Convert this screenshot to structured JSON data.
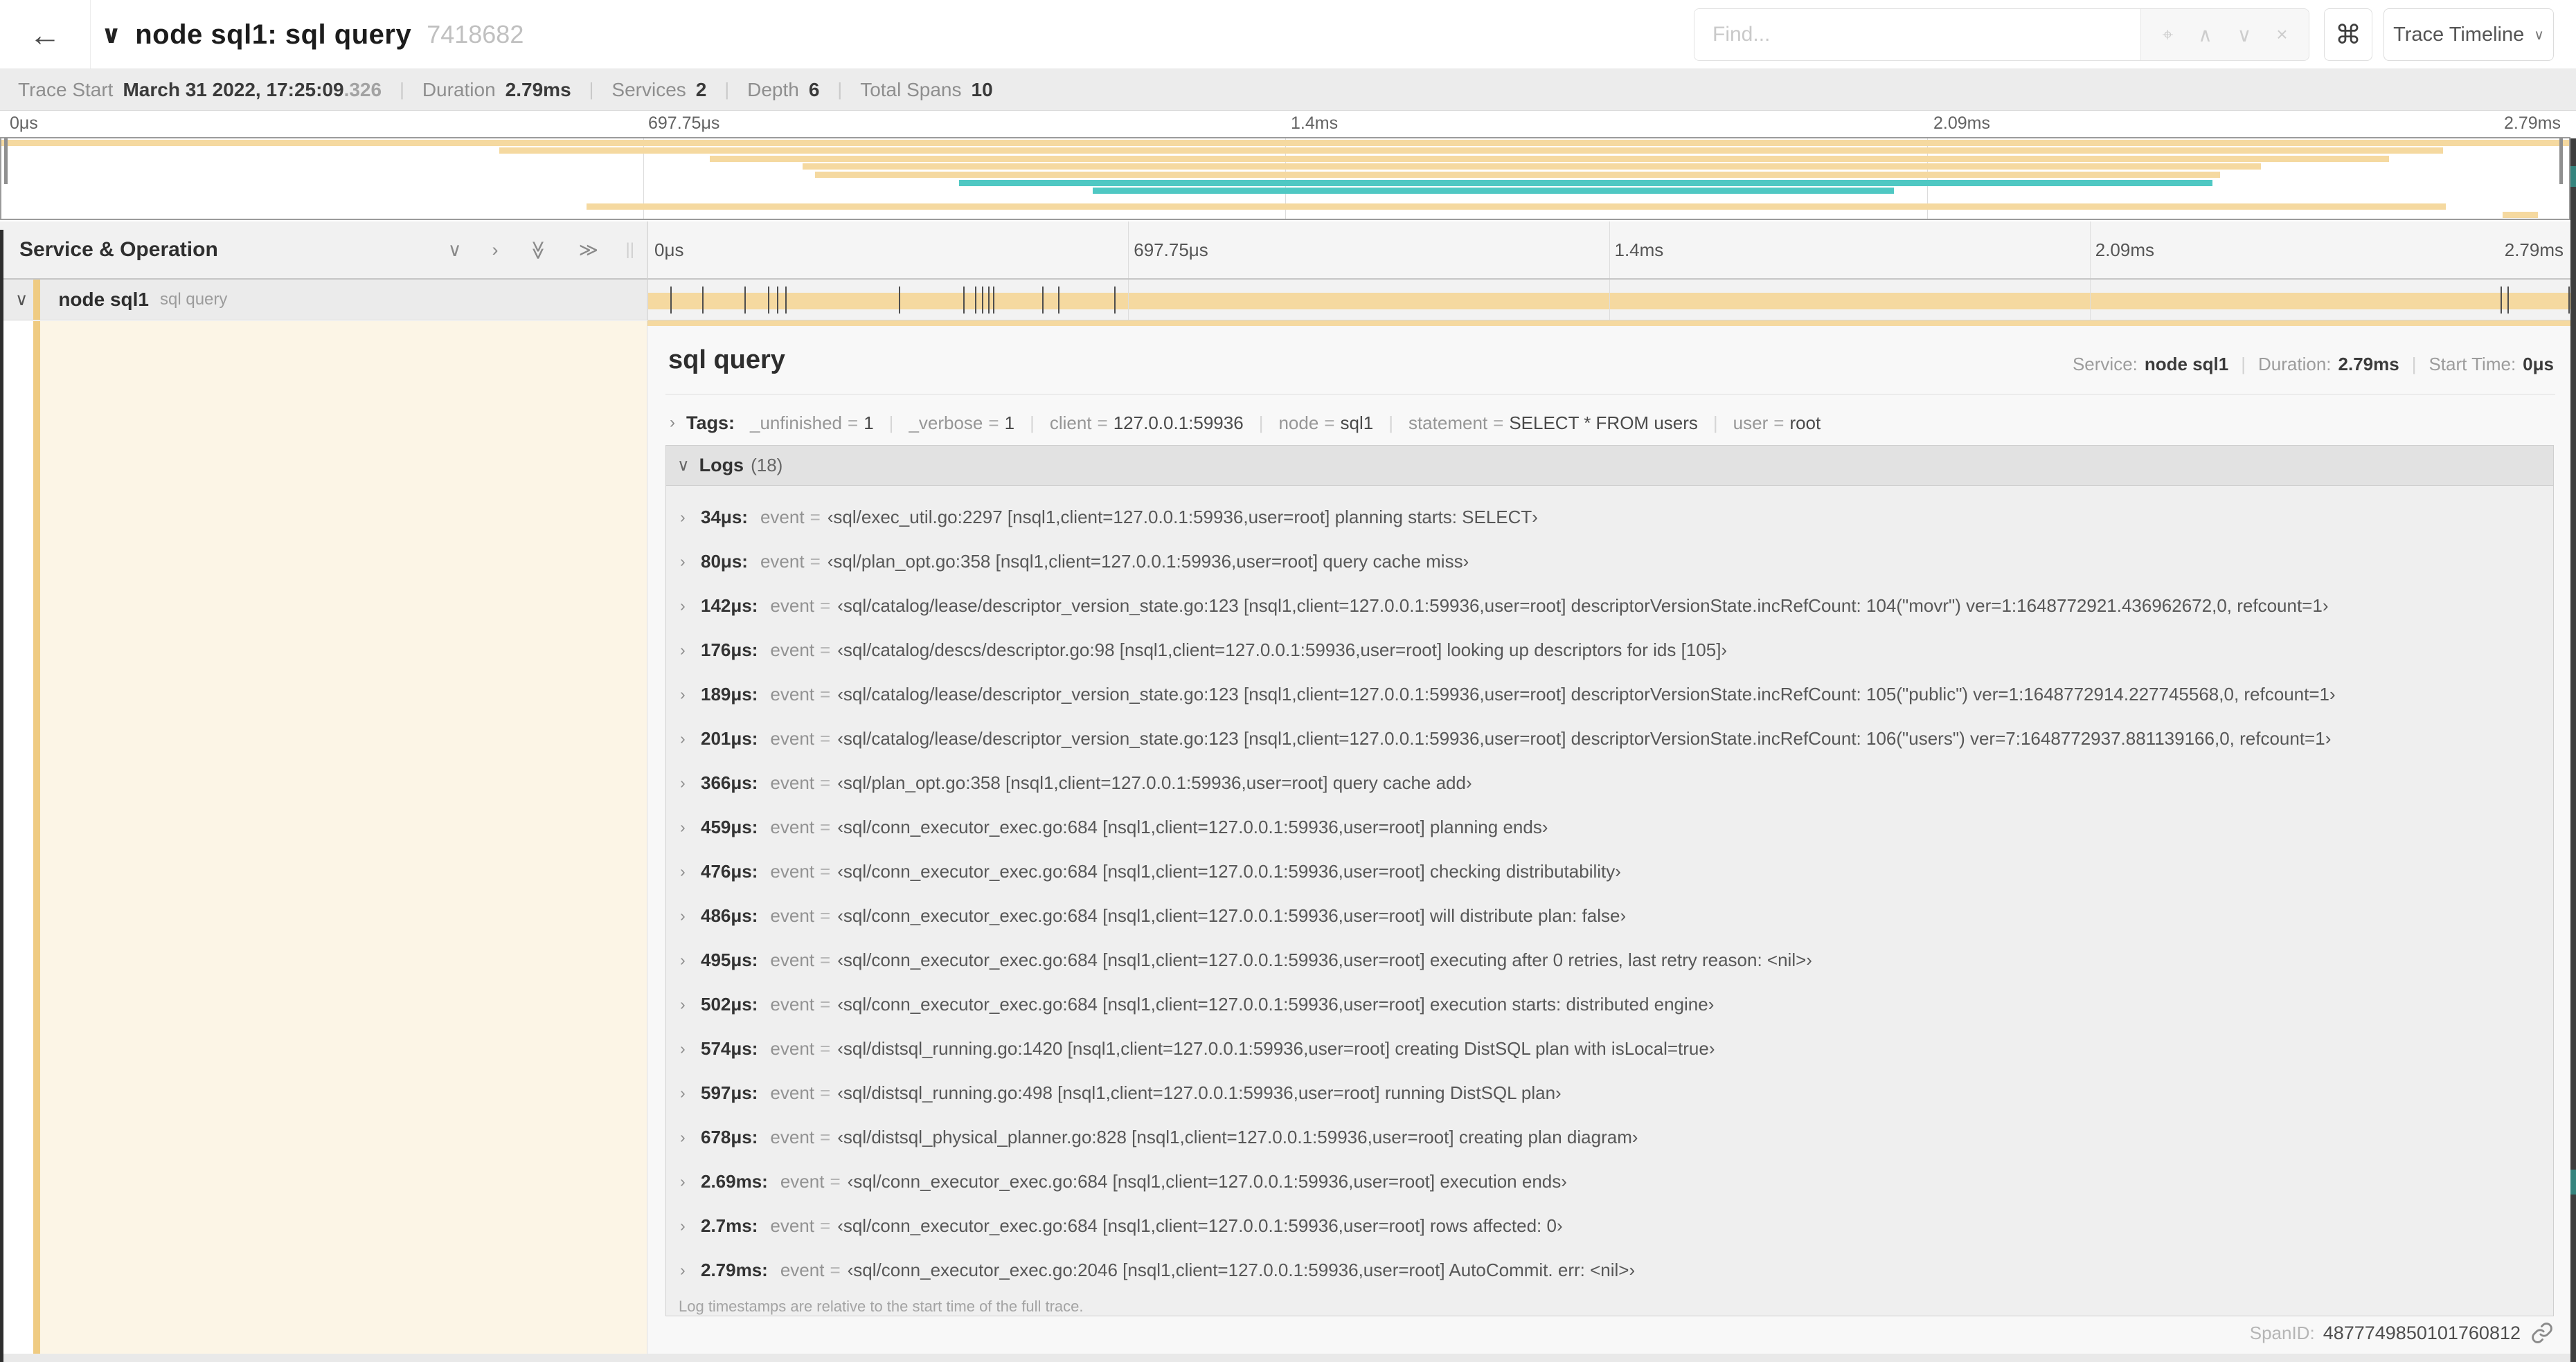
{
  "colors": {
    "span_tan": "#F5D9A0",
    "span_tan_stripe": "#EFCB82",
    "span_teal": "#4FC8C3",
    "detail_cream": "#FCF5E6"
  },
  "icons": {
    "back": "←",
    "title_chevron": "∨",
    "target": "⌖",
    "prev": "∧",
    "next": "∨",
    "clear": "×",
    "command": "⌘",
    "caret": "∨",
    "collapse_one": "∨",
    "expand_one": "›",
    "collapse_all": "≫",
    "expand_all": "≫",
    "resizer": "||",
    "row_chevron": "∨",
    "tags_chevron": "›",
    "logs_chevron": "∨",
    "log_chevron": "›"
  },
  "header": {
    "title": "node sql1: sql query",
    "trace_id": "7418682",
    "find_placeholder": "Find...",
    "trace_timeline_label": "Trace Timeline"
  },
  "summary": {
    "trace_start_label": "Trace Start",
    "trace_start_value": "March 31 2022, 17:25:09",
    "trace_start_frac": ".326",
    "duration_label": "Duration",
    "duration_value": "2.79ms",
    "services_label": "Services",
    "services_value": "2",
    "depth_label": "Depth",
    "depth_value": "6",
    "total_spans_label": "Total Spans",
    "total_spans_value": "10"
  },
  "trace": {
    "duration_us": 2790
  },
  "time_ticks": [
    "0μs",
    "697.75μs",
    "1.4ms",
    "2.09ms",
    "2.79ms"
  ],
  "minimap": {
    "bars": [
      {
        "row": 0,
        "start": 0.0,
        "end": 1.0,
        "color": "span_tan"
      },
      {
        "row": 1,
        "start": 0.194,
        "end": 0.951,
        "color": "span_tan"
      },
      {
        "row": 2,
        "start": 0.276,
        "end": 0.93,
        "color": "span_tan"
      },
      {
        "row": 3,
        "start": 0.312,
        "end": 0.88,
        "color": "span_tan"
      },
      {
        "row": 4,
        "start": 0.317,
        "end": 0.864,
        "color": "span_tan"
      },
      {
        "row": 5,
        "start": 0.373,
        "end": 0.861,
        "color": "span_teal"
      },
      {
        "row": 6,
        "start": 0.425,
        "end": 0.737,
        "color": "span_teal"
      },
      {
        "row": 8,
        "start": 0.228,
        "end": 0.952,
        "color": "span_tan"
      },
      {
        "row": 9,
        "start": 0.974,
        "end": 0.988,
        "color": "span_tan"
      }
    ]
  },
  "timeline": {
    "column_header": "Service & Operation",
    "row": {
      "service": "node sql1",
      "operation": "sql query"
    }
  },
  "detail": {
    "title": "sql query",
    "service_label": "Service:",
    "service": "node sql1",
    "duration_label": "Duration:",
    "duration": "2.79ms",
    "start_label": "Start Time:",
    "start": "0μs",
    "tags_label": "Tags:",
    "tags": [
      {
        "key": "_unfinished",
        "value": "1"
      },
      {
        "key": "_verbose",
        "value": "1"
      },
      {
        "key": "client",
        "value": "127.0.0.1:59936"
      },
      {
        "key": "node",
        "value": "sql1"
      },
      {
        "key": "statement",
        "value": "SELECT * FROM users"
      },
      {
        "key": "user",
        "value": "root"
      }
    ],
    "logs_label": "Logs",
    "logs_count": "(18)",
    "event_key": "event",
    "eq": "=",
    "logs": [
      {
        "t_us": 34,
        "time": "34μs:",
        "event": "‹sql/exec_util.go:2297 [nsql1,client=127.0.0.1:59936,user=root] planning starts: SELECT›"
      },
      {
        "t_us": 80,
        "time": "80μs:",
        "event": "‹sql/plan_opt.go:358 [nsql1,client=127.0.0.1:59936,user=root] query cache miss›"
      },
      {
        "t_us": 142,
        "time": "142μs:",
        "event": "‹sql/catalog/lease/descriptor_version_state.go:123 [nsql1,client=127.0.0.1:59936,user=root] descriptorVersionState.incRefCount: 104(\"movr\") ver=1:1648772921.436962672,0, refcount=1›"
      },
      {
        "t_us": 176,
        "time": "176μs:",
        "event": "‹sql/catalog/descs/descriptor.go:98 [nsql1,client=127.0.0.1:59936,user=root] looking up descriptors for ids [105]›"
      },
      {
        "t_us": 189,
        "time": "189μs:",
        "event": "‹sql/catalog/lease/descriptor_version_state.go:123 [nsql1,client=127.0.0.1:59936,user=root] descriptorVersionState.incRefCount: 105(\"public\") ver=1:1648772914.227745568,0, refcount=1›"
      },
      {
        "t_us": 201,
        "time": "201μs:",
        "event": "‹sql/catalog/lease/descriptor_version_state.go:123 [nsql1,client=127.0.0.1:59936,user=root] descriptorVersionState.incRefCount: 106(\"users\") ver=7:1648772937.881139166,0, refcount=1›"
      },
      {
        "t_us": 366,
        "time": "366μs:",
        "event": "‹sql/plan_opt.go:358 [nsql1,client=127.0.0.1:59936,user=root] query cache add›"
      },
      {
        "t_us": 459,
        "time": "459μs:",
        "event": "‹sql/conn_executor_exec.go:684 [nsql1,client=127.0.0.1:59936,user=root] planning ends›"
      },
      {
        "t_us": 476,
        "time": "476μs:",
        "event": "‹sql/conn_executor_exec.go:684 [nsql1,client=127.0.0.1:59936,user=root] checking distributability›"
      },
      {
        "t_us": 486,
        "time": "486μs:",
        "event": "‹sql/conn_executor_exec.go:684 [nsql1,client=127.0.0.1:59936,user=root] will distribute plan: false›"
      },
      {
        "t_us": 495,
        "time": "495μs:",
        "event": "‹sql/conn_executor_exec.go:684 [nsql1,client=127.0.0.1:59936,user=root] executing after 0 retries, last retry reason: <nil>›"
      },
      {
        "t_us": 502,
        "time": "502μs:",
        "event": "‹sql/conn_executor_exec.go:684 [nsql1,client=127.0.0.1:59936,user=root] execution starts: distributed engine›"
      },
      {
        "t_us": 574,
        "time": "574μs:",
        "event": "‹sql/distsql_running.go:1420 [nsql1,client=127.0.0.1:59936,user=root] creating DistSQL plan with isLocal=true›"
      },
      {
        "t_us": 597,
        "time": "597μs:",
        "event": "‹sql/distsql_running.go:498 [nsql1,client=127.0.0.1:59936,user=root] running DistSQL plan›"
      },
      {
        "t_us": 678,
        "time": "678μs:",
        "event": "‹sql/distsql_physical_planner.go:828 [nsql1,client=127.0.0.1:59936,user=root] creating plan diagram›"
      },
      {
        "t_us": 2690,
        "time": "2.69ms:",
        "event": "‹sql/conn_executor_exec.go:684 [nsql1,client=127.0.0.1:59936,user=root] execution ends›"
      },
      {
        "t_us": 2700,
        "time": "2.7ms:",
        "event": "‹sql/conn_executor_exec.go:684 [nsql1,client=127.0.0.1:59936,user=root] rows affected: 0›"
      },
      {
        "t_us": 2790,
        "time": "2.79ms:",
        "event": "‹sql/conn_executor_exec.go:2046 [nsql1,client=127.0.0.1:59936,user=root] AutoCommit. err: <nil>›"
      }
    ],
    "logs_note": "Log timestamps are relative to the start time of the full trace.",
    "span_id_label": "SpanID:",
    "span_id": "4877749850101760812"
  }
}
